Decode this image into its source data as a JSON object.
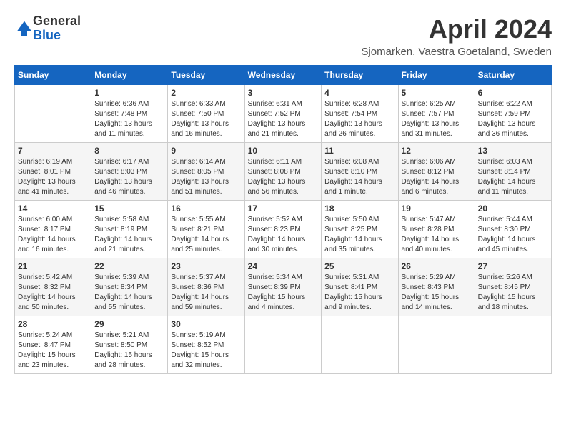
{
  "header": {
    "logo_line1": "General",
    "logo_line2": "Blue",
    "month": "April 2024",
    "location": "Sjomarken, Vaestra Goetaland, Sweden"
  },
  "weekdays": [
    "Sunday",
    "Monday",
    "Tuesday",
    "Wednesday",
    "Thursday",
    "Friday",
    "Saturday"
  ],
  "weeks": [
    [
      {
        "day": "",
        "sunrise": "",
        "sunset": "",
        "daylight": ""
      },
      {
        "day": "1",
        "sunrise": "Sunrise: 6:36 AM",
        "sunset": "Sunset: 7:48 PM",
        "daylight": "Daylight: 13 hours and 11 minutes."
      },
      {
        "day": "2",
        "sunrise": "Sunrise: 6:33 AM",
        "sunset": "Sunset: 7:50 PM",
        "daylight": "Daylight: 13 hours and 16 minutes."
      },
      {
        "day": "3",
        "sunrise": "Sunrise: 6:31 AM",
        "sunset": "Sunset: 7:52 PM",
        "daylight": "Daylight: 13 hours and 21 minutes."
      },
      {
        "day": "4",
        "sunrise": "Sunrise: 6:28 AM",
        "sunset": "Sunset: 7:54 PM",
        "daylight": "Daylight: 13 hours and 26 minutes."
      },
      {
        "day": "5",
        "sunrise": "Sunrise: 6:25 AM",
        "sunset": "Sunset: 7:57 PM",
        "daylight": "Daylight: 13 hours and 31 minutes."
      },
      {
        "day": "6",
        "sunrise": "Sunrise: 6:22 AM",
        "sunset": "Sunset: 7:59 PM",
        "daylight": "Daylight: 13 hours and 36 minutes."
      }
    ],
    [
      {
        "day": "7",
        "sunrise": "Sunrise: 6:19 AM",
        "sunset": "Sunset: 8:01 PM",
        "daylight": "Daylight: 13 hours and 41 minutes."
      },
      {
        "day": "8",
        "sunrise": "Sunrise: 6:17 AM",
        "sunset": "Sunset: 8:03 PM",
        "daylight": "Daylight: 13 hours and 46 minutes."
      },
      {
        "day": "9",
        "sunrise": "Sunrise: 6:14 AM",
        "sunset": "Sunset: 8:05 PM",
        "daylight": "Daylight: 13 hours and 51 minutes."
      },
      {
        "day": "10",
        "sunrise": "Sunrise: 6:11 AM",
        "sunset": "Sunset: 8:08 PM",
        "daylight": "Daylight: 13 hours and 56 minutes."
      },
      {
        "day": "11",
        "sunrise": "Sunrise: 6:08 AM",
        "sunset": "Sunset: 8:10 PM",
        "daylight": "Daylight: 14 hours and 1 minute."
      },
      {
        "day": "12",
        "sunrise": "Sunrise: 6:06 AM",
        "sunset": "Sunset: 8:12 PM",
        "daylight": "Daylight: 14 hours and 6 minutes."
      },
      {
        "day": "13",
        "sunrise": "Sunrise: 6:03 AM",
        "sunset": "Sunset: 8:14 PM",
        "daylight": "Daylight: 14 hours and 11 minutes."
      }
    ],
    [
      {
        "day": "14",
        "sunrise": "Sunrise: 6:00 AM",
        "sunset": "Sunset: 8:17 PM",
        "daylight": "Daylight: 14 hours and 16 minutes."
      },
      {
        "day": "15",
        "sunrise": "Sunrise: 5:58 AM",
        "sunset": "Sunset: 8:19 PM",
        "daylight": "Daylight: 14 hours and 21 minutes."
      },
      {
        "day": "16",
        "sunrise": "Sunrise: 5:55 AM",
        "sunset": "Sunset: 8:21 PM",
        "daylight": "Daylight: 14 hours and 25 minutes."
      },
      {
        "day": "17",
        "sunrise": "Sunrise: 5:52 AM",
        "sunset": "Sunset: 8:23 PM",
        "daylight": "Daylight: 14 hours and 30 minutes."
      },
      {
        "day": "18",
        "sunrise": "Sunrise: 5:50 AM",
        "sunset": "Sunset: 8:25 PM",
        "daylight": "Daylight: 14 hours and 35 minutes."
      },
      {
        "day": "19",
        "sunrise": "Sunrise: 5:47 AM",
        "sunset": "Sunset: 8:28 PM",
        "daylight": "Daylight: 14 hours and 40 minutes."
      },
      {
        "day": "20",
        "sunrise": "Sunrise: 5:44 AM",
        "sunset": "Sunset: 8:30 PM",
        "daylight": "Daylight: 14 hours and 45 minutes."
      }
    ],
    [
      {
        "day": "21",
        "sunrise": "Sunrise: 5:42 AM",
        "sunset": "Sunset: 8:32 PM",
        "daylight": "Daylight: 14 hours and 50 minutes."
      },
      {
        "day": "22",
        "sunrise": "Sunrise: 5:39 AM",
        "sunset": "Sunset: 8:34 PM",
        "daylight": "Daylight: 14 hours and 55 minutes."
      },
      {
        "day": "23",
        "sunrise": "Sunrise: 5:37 AM",
        "sunset": "Sunset: 8:36 PM",
        "daylight": "Daylight: 14 hours and 59 minutes."
      },
      {
        "day": "24",
        "sunrise": "Sunrise: 5:34 AM",
        "sunset": "Sunset: 8:39 PM",
        "daylight": "Daylight: 15 hours and 4 minutes."
      },
      {
        "day": "25",
        "sunrise": "Sunrise: 5:31 AM",
        "sunset": "Sunset: 8:41 PM",
        "daylight": "Daylight: 15 hours and 9 minutes."
      },
      {
        "day": "26",
        "sunrise": "Sunrise: 5:29 AM",
        "sunset": "Sunset: 8:43 PM",
        "daylight": "Daylight: 15 hours and 14 minutes."
      },
      {
        "day": "27",
        "sunrise": "Sunrise: 5:26 AM",
        "sunset": "Sunset: 8:45 PM",
        "daylight": "Daylight: 15 hours and 18 minutes."
      }
    ],
    [
      {
        "day": "28",
        "sunrise": "Sunrise: 5:24 AM",
        "sunset": "Sunset: 8:47 PM",
        "daylight": "Daylight: 15 hours and 23 minutes."
      },
      {
        "day": "29",
        "sunrise": "Sunrise: 5:21 AM",
        "sunset": "Sunset: 8:50 PM",
        "daylight": "Daylight: 15 hours and 28 minutes."
      },
      {
        "day": "30",
        "sunrise": "Sunrise: 5:19 AM",
        "sunset": "Sunset: 8:52 PM",
        "daylight": "Daylight: 15 hours and 32 minutes."
      },
      {
        "day": "",
        "sunrise": "",
        "sunset": "",
        "daylight": ""
      },
      {
        "day": "",
        "sunrise": "",
        "sunset": "",
        "daylight": ""
      },
      {
        "day": "",
        "sunrise": "",
        "sunset": "",
        "daylight": ""
      },
      {
        "day": "",
        "sunrise": "",
        "sunset": "",
        "daylight": ""
      }
    ]
  ]
}
